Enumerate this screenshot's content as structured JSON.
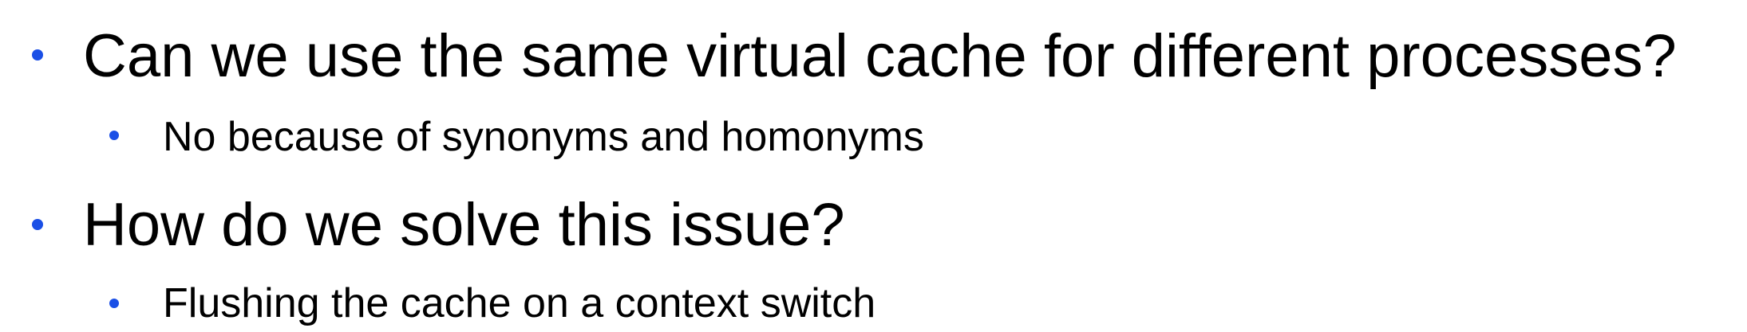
{
  "bullets": [
    {
      "level": 1,
      "text": "Can we use the same virtual cache for different processes?"
    },
    {
      "level": 2,
      "text": "No because of synonyms and homonyms"
    },
    {
      "level": 1,
      "text": "How do we solve this issue?"
    },
    {
      "level": 2,
      "text": "Flushing the cache on a context switch"
    }
  ],
  "colors": {
    "bullet": "#1a4fe6",
    "text": "#000000",
    "background": "#ffffff"
  }
}
